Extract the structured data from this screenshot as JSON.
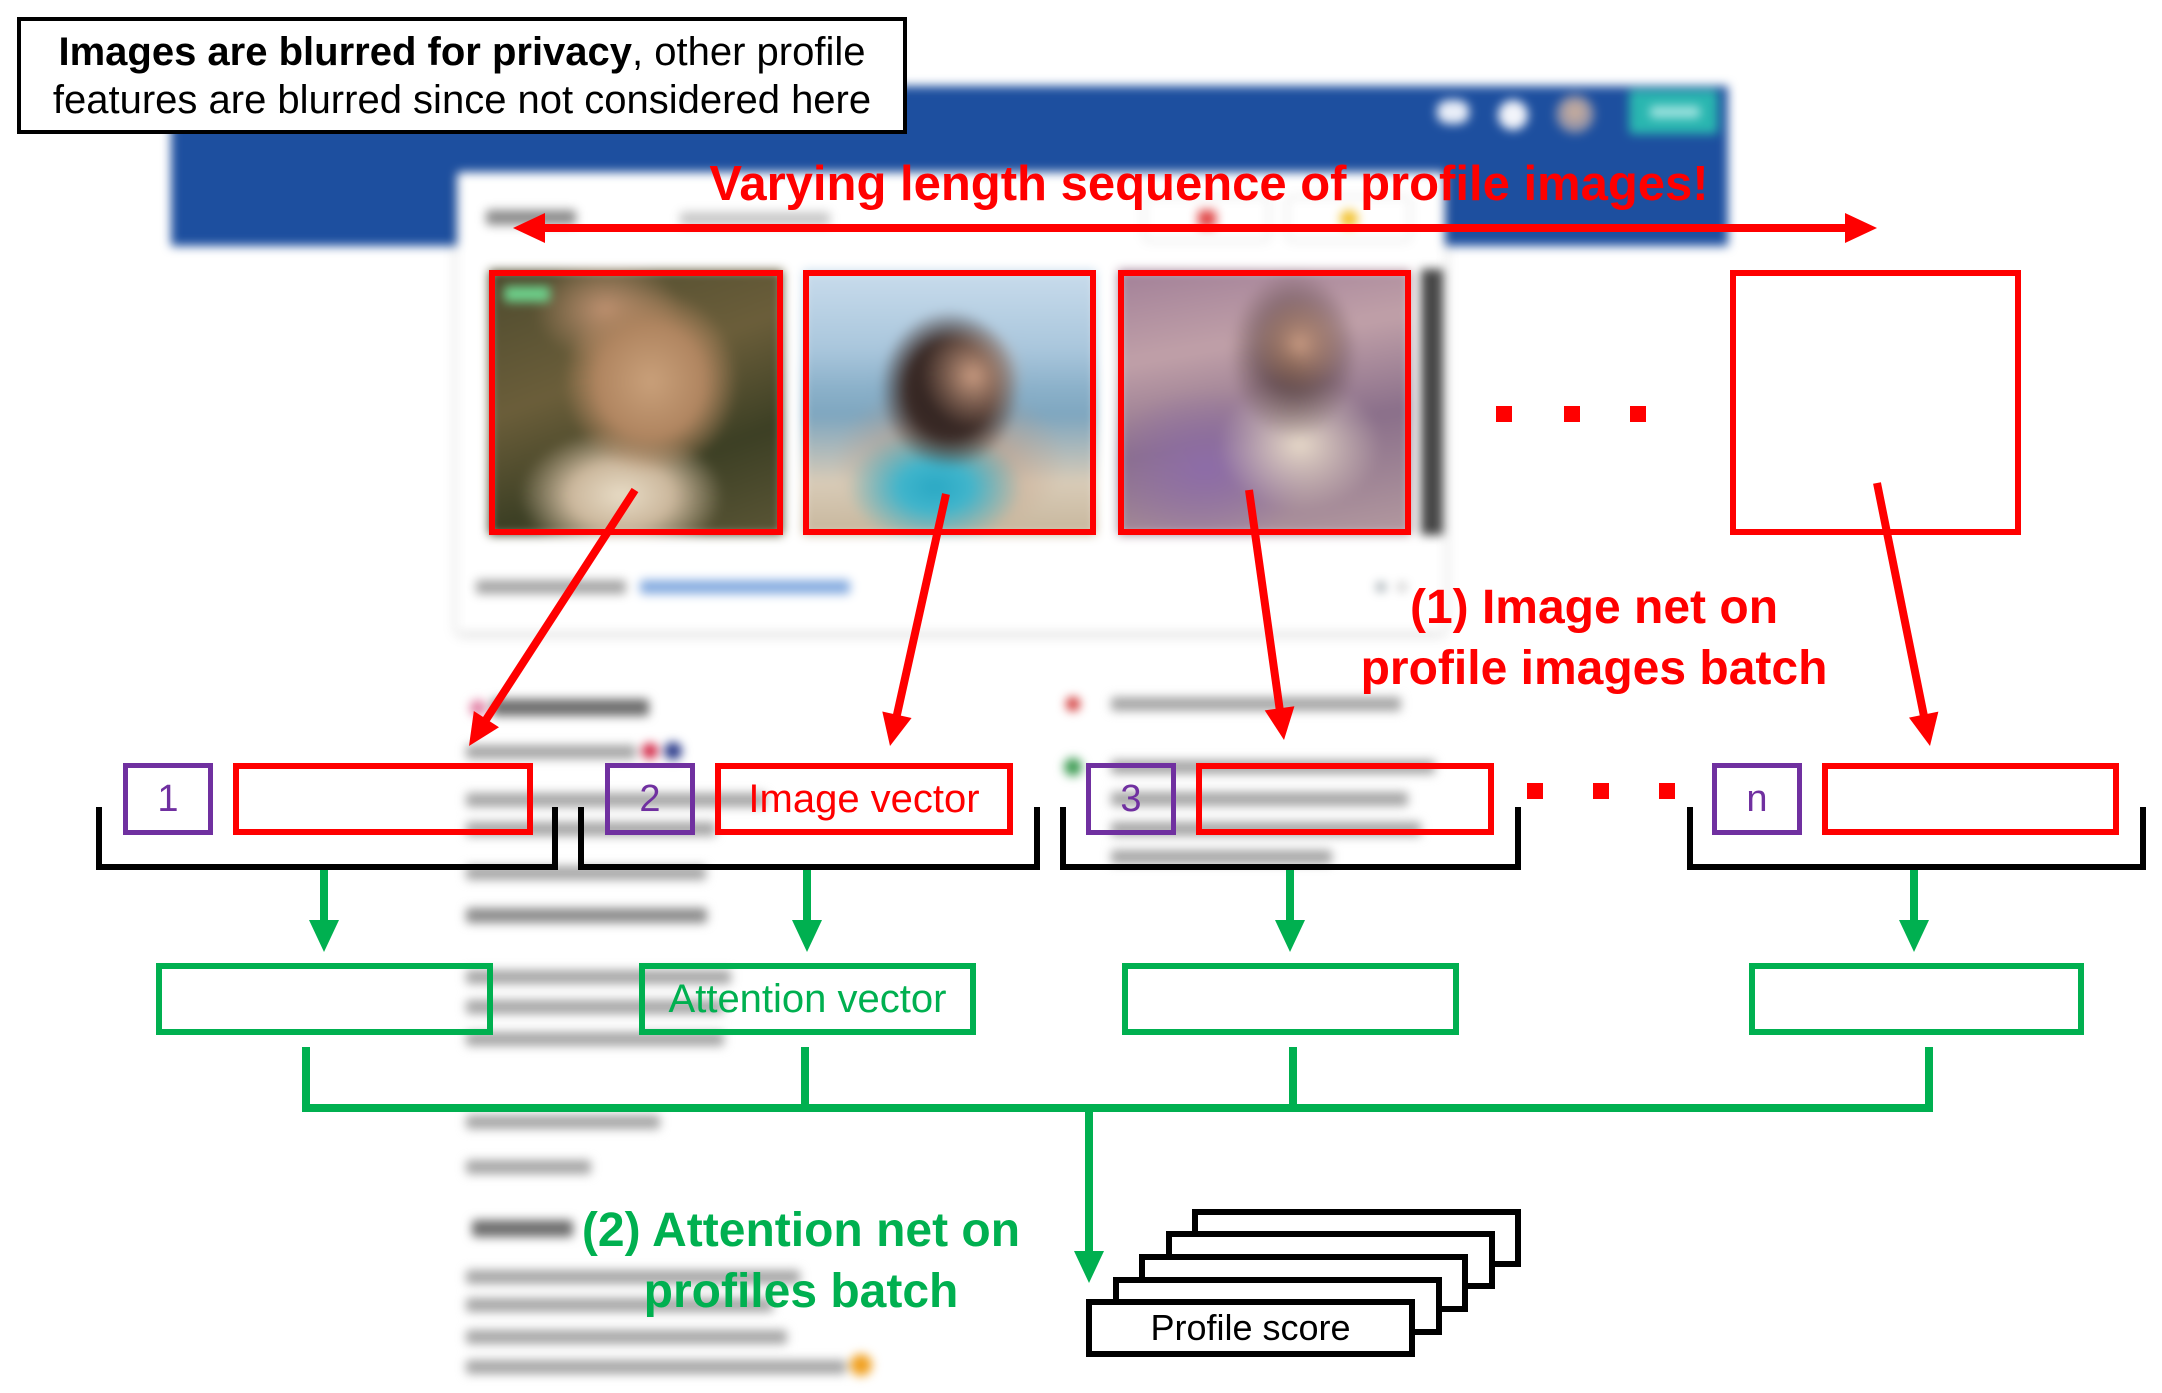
{
  "note": {
    "bold_text": "Images are blurred for privacy",
    "line1_rest": ", other profile",
    "line2": "features are blurred since not considered here"
  },
  "sequence_label": "Varying length sequence of profile images!",
  "image_net": {
    "line1": "(1) Image net on",
    "line2": "profile images batch"
  },
  "profiles": [
    {
      "index": "1"
    },
    {
      "index": "2",
      "image_vector_label": "Image vector",
      "attention_vector_label": "Attention vector"
    },
    {
      "index": "3"
    },
    {
      "index": "n"
    }
  ],
  "attention_net": {
    "line1": "(2) Attention net on",
    "line2": "profiles batch"
  },
  "output_label": "Profile score",
  "colors": {
    "image_path": "#ff0000",
    "index": "#7030a0",
    "attention_path": "#00b050",
    "bracket": "#000000",
    "header": "#1d4f9f"
  }
}
